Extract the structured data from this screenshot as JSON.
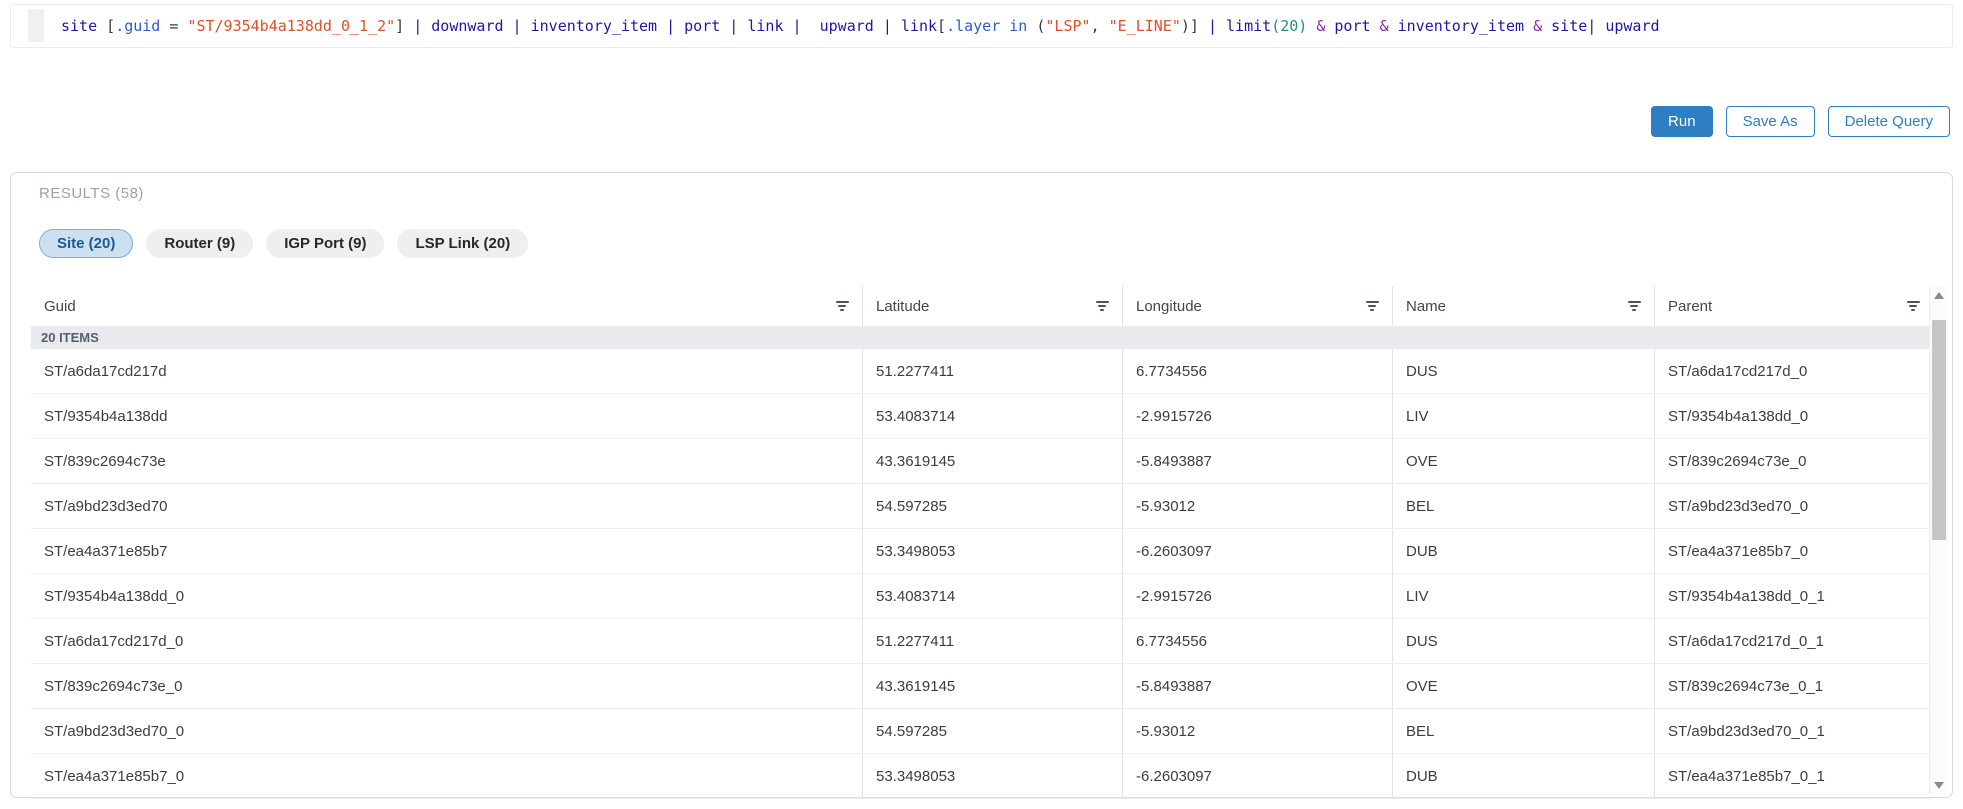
{
  "query_editor": {
    "tokens": [
      {
        "t": "site ",
        "c": "kw"
      },
      {
        "t": "[",
        "c": "pun"
      },
      {
        "t": ".guid",
        "c": "prop"
      },
      {
        "t": " = ",
        "c": "pun"
      },
      {
        "t": "\"ST/9354b4a138dd_0_1_2\"",
        "c": "str"
      },
      {
        "t": "]",
        "c": "pun"
      },
      {
        "t": " | ",
        "c": "pipe"
      },
      {
        "t": "downward",
        "c": "kw"
      },
      {
        "t": " | ",
        "c": "pipe"
      },
      {
        "t": "inventory_item",
        "c": "kw"
      },
      {
        "t": " | ",
        "c": "pipe"
      },
      {
        "t": "port",
        "c": "kw"
      },
      {
        "t": " | ",
        "c": "pipe"
      },
      {
        "t": "link",
        "c": "kw"
      },
      {
        "t": " |  ",
        "c": "pipe"
      },
      {
        "t": "upward",
        "c": "kw"
      },
      {
        "t": " | ",
        "c": "pipe"
      },
      {
        "t": "link",
        "c": "kw"
      },
      {
        "t": "[",
        "c": "pun"
      },
      {
        "t": ".layer",
        "c": "prop"
      },
      {
        "t": " in ",
        "c": "prop"
      },
      {
        "t": "(",
        "c": "pun"
      },
      {
        "t": "\"LSP\"",
        "c": "str"
      },
      {
        "t": ", ",
        "c": "pun"
      },
      {
        "t": "\"E_LINE\"",
        "c": "str"
      },
      {
        "t": ")",
        "c": "pun"
      },
      {
        "t": "]",
        "c": "pun"
      },
      {
        "t": " | ",
        "c": "pipe"
      },
      {
        "t": "limit",
        "c": "kw"
      },
      {
        "t": "(",
        "c": "num"
      },
      {
        "t": "20",
        "c": "num"
      },
      {
        "t": ")",
        "c": "num"
      },
      {
        "t": " ",
        "c": "pun"
      },
      {
        "t": "&",
        "c": "amp"
      },
      {
        "t": " ",
        "c": "pun"
      },
      {
        "t": "port",
        "c": "kw"
      },
      {
        "t": " ",
        "c": "pun"
      },
      {
        "t": "&",
        "c": "amp"
      },
      {
        "t": " ",
        "c": "pun"
      },
      {
        "t": "inventory_item",
        "c": "kw"
      },
      {
        "t": " ",
        "c": "pun"
      },
      {
        "t": "&",
        "c": "amp"
      },
      {
        "t": " ",
        "c": "pun"
      },
      {
        "t": "site",
        "c": "kw"
      },
      {
        "t": "| ",
        "c": "pipe"
      },
      {
        "t": "upward",
        "c": "kw"
      }
    ]
  },
  "toolbar": {
    "run_label": "Run",
    "save_as_label": "Save As",
    "delete_query_label": "Delete Query",
    "accent_color": "#2d7fc1"
  },
  "results": {
    "title": "RESULTS (58)",
    "tabs": [
      {
        "label": "Site (20)",
        "active": true
      },
      {
        "label": "Router (9)",
        "active": false
      },
      {
        "label": "IGP Port (9)",
        "active": false
      },
      {
        "label": "LSP Link (20)",
        "active": false
      }
    ],
    "group_header": "20 ITEMS",
    "columns": [
      "Guid",
      "Latitude",
      "Longitude",
      "Name",
      "Parent"
    ],
    "filter_icon": "filter-icon",
    "rows": [
      [
        "ST/a6da17cd217d",
        "51.2277411",
        "6.7734556",
        "DUS",
        "ST/a6da17cd217d_0"
      ],
      [
        "ST/9354b4a138dd",
        "53.4083714",
        "-2.9915726",
        "LIV",
        "ST/9354b4a138dd_0"
      ],
      [
        "ST/839c2694c73e",
        "43.3619145",
        "-5.8493887",
        "OVE",
        "ST/839c2694c73e_0"
      ],
      [
        "ST/a9bd23d3ed70",
        "54.597285",
        "-5.93012",
        "BEL",
        "ST/a9bd23d3ed70_0"
      ],
      [
        "ST/ea4a371e85b7",
        "53.3498053",
        "-6.2603097",
        "DUB",
        "ST/ea4a371e85b7_0"
      ],
      [
        "ST/9354b4a138dd_0",
        "53.4083714",
        "-2.9915726",
        "LIV",
        "ST/9354b4a138dd_0_1"
      ],
      [
        "ST/a6da17cd217d_0",
        "51.2277411",
        "6.7734556",
        "DUS",
        "ST/a6da17cd217d_0_1"
      ],
      [
        "ST/839c2694c73e_0",
        "43.3619145",
        "-5.8493887",
        "OVE",
        "ST/839c2694c73e_0_1"
      ],
      [
        "ST/a9bd23d3ed70_0",
        "54.597285",
        "-5.93012",
        "BEL",
        "ST/a9bd23d3ed70_0_1"
      ],
      [
        "ST/ea4a371e85b7_0",
        "53.3498053",
        "-6.2603097",
        "DUB",
        "ST/ea4a371e85b7_0_1"
      ]
    ]
  }
}
